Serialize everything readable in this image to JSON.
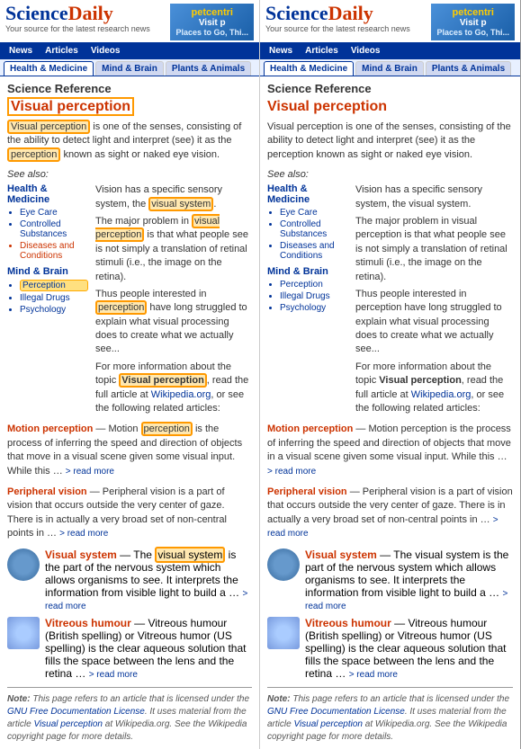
{
  "panels": [
    {
      "id": "left",
      "logo": "ScienceDaily",
      "tagline": "Your source for the latest research news",
      "ad": {
        "brand": "petcentri",
        "line1": "Visit p",
        "line2": "Places to Go, Thi..."
      },
      "nav": [
        "News",
        "Articles",
        "Videos"
      ],
      "tabs": [
        {
          "label": "Health & Medicine",
          "active": true
        },
        {
          "label": "Mind & Brain",
          "active": false
        },
        {
          "label": "Plants & Animals",
          "active": false
        }
      ],
      "section_title": "Science Reference",
      "article_title": "Visual perception",
      "article_body_before": "Visual perception",
      "article_body_mid1": " is one of the senses, consisting of the ability to detect light and interpret (see) it as the ",
      "article_body_word2": "perception",
      "article_body_mid2": " known as sight or naked eye vision.",
      "see_also": "See also:",
      "health_section": {
        "title": "Health & Medicine",
        "items": [
          "Eye Care",
          "Controlled Substances",
          "Diseases and Conditions"
        ]
      },
      "mind_section": {
        "title": "Mind & Brain",
        "items": [
          "Perception",
          "Illegal Drugs",
          "Psychology"
        ]
      },
      "main_text": "Vision has a specific sensory system, the visual system.",
      "main_text2": "The major problem in visual",
      "perception_highlight2": "perception",
      "main_text3": " is that what people see is not simply a translation of retinal stimuli (i.e., the image on the retina).",
      "main_text4": "Thus people interested in ",
      "perception_highlight3": "perception",
      "main_text5": " have long struggled to explain what visual processing does to create what we actually see...",
      "more_info": "For more information about the topic",
      "visual_perception_link": "Visual perception",
      "more_info2": ", read the full article at Wikipedia.org, or see the following related articles:",
      "related": [
        {
          "title": "Motion perception",
          "title_highlight": "perception",
          "body": " — Motion perception is the process of inferring the speed and direction of objects that move in a visual scene given some visual input. While this …",
          "read_more": "> read more",
          "has_thumb": false
        },
        {
          "title": "Peripheral vision",
          "body": " — Peripheral vision is a part of vision that occurs outside the very center of gaze. There is in actually a very broad set of non-central points in … ",
          "read_more": "> read more",
          "has_thumb": false
        },
        {
          "title": "Visual system",
          "body": " — The visual system is the part of the nervous system which allows organisms to see. It interprets the information from visible light to build a … ",
          "read_more": "> read more",
          "has_thumb": true,
          "thumb_type": "eye"
        },
        {
          "title": "Vitreous humour",
          "body": " — Vitreous humour (British spelling) or Vitreous humor (US spelling) is the clear aqueous solution that fills the space between the lens and the retina … ",
          "read_more": "> read more",
          "has_thumb": true,
          "thumb_type": "glass"
        }
      ],
      "note": "Note: This page refers to an article that is licensed under the GNU Free Documentation License. It uses material from the article Visual perception at Wikipedia.org. See the Wikipedia copyright page for more details."
    },
    {
      "id": "right",
      "logo": "ScienceDaily",
      "tagline": "Your source for the latest research news",
      "ad": {
        "brand": "petcentri",
        "line1": "Visit p",
        "line2": "Places to Go, Thi..."
      },
      "nav": [
        "News",
        "Articles",
        "Videos"
      ],
      "tabs": [
        {
          "label": "Health & Medicine",
          "active": true
        },
        {
          "label": "Mind & Brain",
          "active": false
        },
        {
          "label": "Plants & Animals",
          "active": false
        }
      ],
      "section_title": "Science Reference",
      "article_title": "Visual perception",
      "article_body": "Visual perception is one of the senses, consisting of the ability to detect light and interpret (see) it as the perception known as sight or naked eye vision.",
      "see_also": "See also:",
      "health_section": {
        "title": "Health & Medicine",
        "items": [
          "Eye Care",
          "Controlled Substances",
          "Diseases and Conditions"
        ]
      },
      "mind_section": {
        "title": "Mind & Brain",
        "items": [
          "Perception",
          "Illegal Drugs",
          "Psychology"
        ]
      },
      "main_text_full": "Vision has a specific sensory system, the visual system.\n\nThe major problem in visual perception is that what people see is not simply a translation of retinal stimuli (i.e., the image on the retina).\n\nThus people interested in perception have long struggled to explain what visual processing does to create what we actually see...",
      "more_info": "For more information about the topic Visual perception, read the full article at Wikipedia.org, or see the following related articles:",
      "related": [
        {
          "title": "Motion perception",
          "body": " — Motion perception is the process of inferring the speed and direction of objects that move in a visual scene given some visual input. While this …",
          "read_more": "> read more",
          "has_thumb": false
        },
        {
          "title": "Peripheral vision",
          "body": " — Peripheral vision is a part of vision that occurs outside the very center of gaze. There is in actually a very broad set of non-central points in … ",
          "read_more": "> read more",
          "has_thumb": false
        },
        {
          "title": "Visual system",
          "body": " — The visual system is the part of the nervous system which allows organisms to see. It interprets the information from visible light to build a … ",
          "read_more": "> read more",
          "has_thumb": true,
          "thumb_type": "eye"
        },
        {
          "title": "Vitreous humour",
          "body": " — Vitreous humour (British spelling) or Vitreous humor (US spelling) is the clear aqueous solution that fills the space between the lens and the retina … ",
          "read_more": "> read more",
          "has_thumb": true,
          "thumb_type": "glass"
        }
      ],
      "note": "Note: This page refers to an article that is licensed under the GNU Free Documentation License. It uses material from the article Visual perception at Wikipedia.org. See the Wikipedia copyright page for more details."
    }
  ]
}
